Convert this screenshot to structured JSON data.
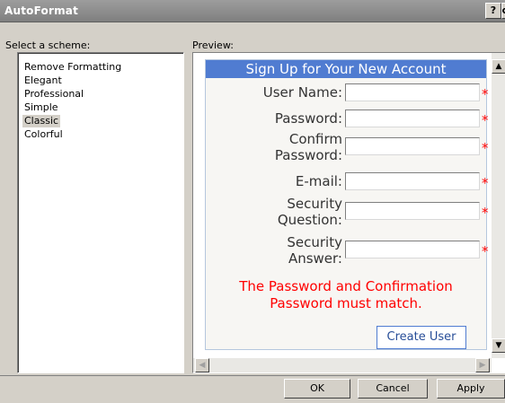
{
  "window": {
    "title": "AutoFormat",
    "help_button": "?",
    "close_button": "x"
  },
  "scheme_panel": {
    "label": "Select a scheme:",
    "items": [
      "Remove Formatting",
      "Elegant",
      "Professional",
      "Simple",
      "Classic",
      "Colorful"
    ],
    "selected": "Classic"
  },
  "preview_panel": {
    "label": "Preview:",
    "form": {
      "title": "Sign Up for Your New Account",
      "fields": [
        {
          "label_line1": "User Name:",
          "label_line2": ""
        },
        {
          "label_line1": "Password:",
          "label_line2": ""
        },
        {
          "label_line1": "Confirm",
          "label_line2": "Password:"
        },
        {
          "label_line1": "E-mail:",
          "label_line2": ""
        },
        {
          "label_line1": "Security",
          "label_line2": "Question:"
        },
        {
          "label_line1": "Security",
          "label_line2": "Answer:"
        }
      ],
      "required_marker": "*",
      "error_line1": "The Password and Confirmation",
      "error_line2": "Password must match.",
      "submit_label": "Create User"
    },
    "scroll_up": "▲",
    "scroll_down": "▼",
    "scroll_left": "◀",
    "scroll_right": "▶"
  },
  "buttons": {
    "ok": "OK",
    "cancel": "Cancel",
    "apply": "Apply"
  },
  "colors": {
    "form_header": "#507cd1",
    "form_background": "#f7f6f3",
    "error_text": "#ff0000",
    "dialog_background": "#d4d0c8"
  }
}
